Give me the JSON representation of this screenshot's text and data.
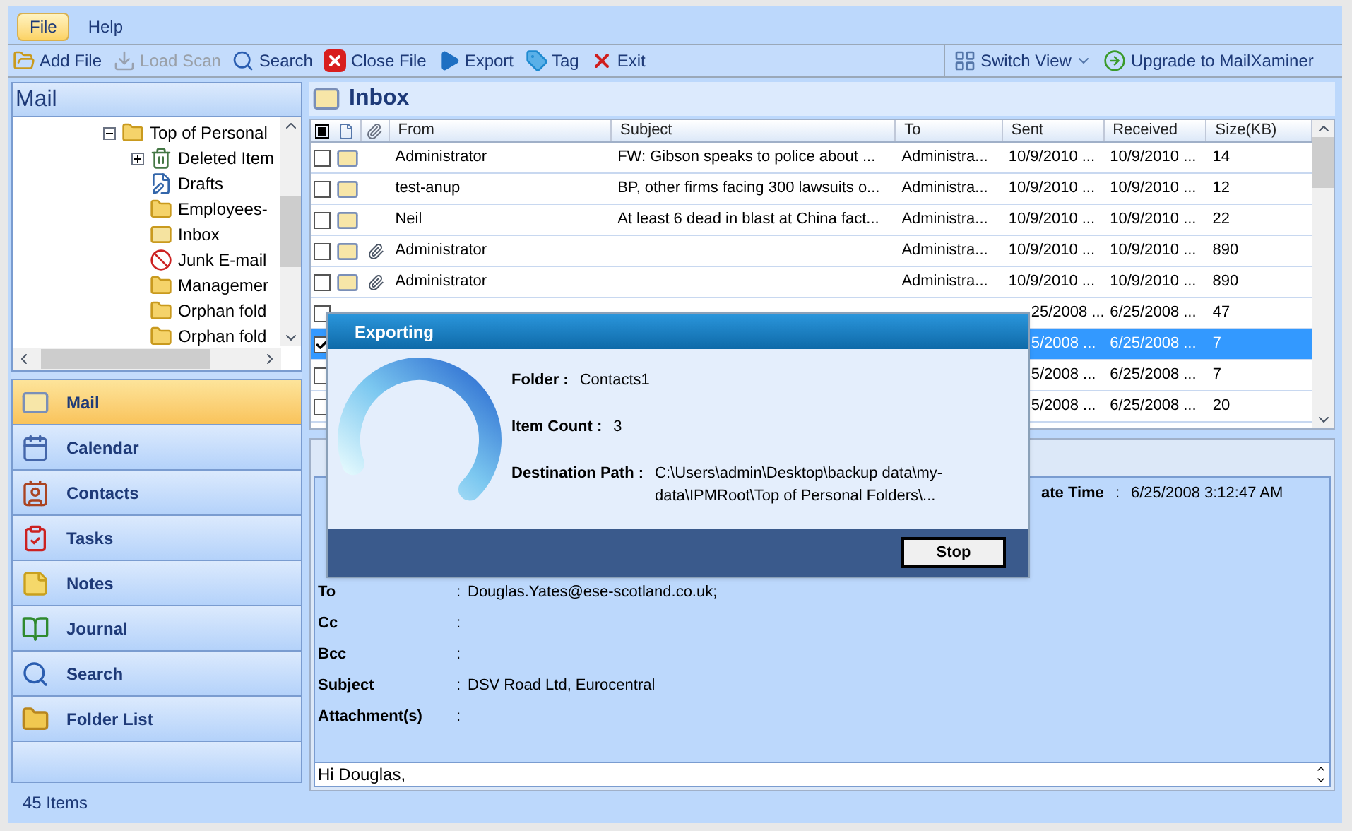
{
  "menu": [
    {
      "label": "File",
      "selected": true
    },
    {
      "label": "Help",
      "selected": false
    }
  ],
  "toolbar": [
    {
      "kind": "open",
      "label": "Add File",
      "disabled": false
    },
    {
      "kind": "download",
      "label": "Load Scan",
      "disabled": true
    },
    {
      "kind": "search",
      "label": "Search",
      "disabled": false
    },
    {
      "kind": "close",
      "label": "Close File",
      "disabled": false
    },
    {
      "kind": "play",
      "label": "Export",
      "disabled": false
    },
    {
      "kind": "tag",
      "label": "Tag",
      "disabled": false
    },
    {
      "kind": "exit",
      "label": "Exit",
      "disabled": false
    }
  ],
  "toolbar_right": [
    {
      "kind": "grid",
      "label": "Switch View",
      "dropdown": true
    },
    {
      "kind": "arrow",
      "label": "Upgrade to MailXaminer",
      "dropdown": false
    }
  ],
  "left_pane": {
    "title": "Mail",
    "tree": [
      {
        "label": "Top of Personal",
        "kind": "folder",
        "expanded": true,
        "children": [
          {
            "label": "Deleted Item",
            "kind": "deleted",
            "expanded": false
          },
          {
            "label": "Drafts",
            "kind": "drafts"
          },
          {
            "label": "Employees-",
            "kind": "folder"
          },
          {
            "label": "Inbox",
            "kind": "inbox"
          },
          {
            "label": "Junk E-mail",
            "kind": "junk"
          },
          {
            "label": "Managemer",
            "kind": "folder"
          },
          {
            "label": "Orphan fold",
            "kind": "folder"
          },
          {
            "label": "Orphan fold",
            "kind": "folder"
          }
        ]
      }
    ]
  },
  "nav": [
    {
      "kind": "mail",
      "label": "Mail",
      "selected": true
    },
    {
      "kind": "calendar",
      "label": "Calendar",
      "selected": false
    },
    {
      "kind": "contacts",
      "label": "Contacts",
      "selected": false
    },
    {
      "kind": "tasks",
      "label": "Tasks",
      "selected": false
    },
    {
      "kind": "notes",
      "label": "Notes",
      "selected": false
    },
    {
      "kind": "journal",
      "label": "Journal",
      "selected": false
    },
    {
      "kind": "search",
      "label": "Search",
      "selected": false
    },
    {
      "kind": "folder",
      "label": "Folder List",
      "selected": false
    }
  ],
  "status_bar": "45 Items",
  "inbox": {
    "title": "Inbox",
    "select_all_indeterminate": true,
    "columns": [
      "From",
      "Subject",
      "To",
      "Sent",
      "Received",
      "Size(KB)"
    ],
    "rows": [
      {
        "checked": false,
        "attachment": false,
        "selected": false,
        "from": "Administrator",
        "subject": "FW: Gibson speaks to police about ...",
        "to": "Administra...",
        "sent": "10/9/2010 ...",
        "received": "10/9/2010 ...",
        "size": "14"
      },
      {
        "checked": false,
        "attachment": false,
        "selected": false,
        "from": "test-anup",
        "subject": "BP, other firms facing 300 lawsuits o...",
        "to": "Administra...",
        "sent": "10/9/2010 ...",
        "received": "10/9/2010 ...",
        "size": "12"
      },
      {
        "checked": false,
        "attachment": false,
        "selected": false,
        "from": "Neil",
        "subject": "At least 6 dead in blast at China fact...",
        "to": "Administra...",
        "sent": "10/9/2010 ...",
        "received": "10/9/2010 ...",
        "size": "22"
      },
      {
        "checked": false,
        "attachment": true,
        "selected": false,
        "from": "Administrator",
        "to": "Administra...",
        "sent": "10/9/2010 ...",
        "received": "10/9/2010 ...",
        "size": "890"
      },
      {
        "checked": false,
        "attachment": true,
        "selected": false,
        "from": "Administrator",
        "to": "Administra...",
        "sent": "10/9/2010 ...",
        "received": "10/9/2010 ...",
        "size": "890"
      },
      {
        "checked": false,
        "selected": false,
        "sent": "25/2008 ...",
        "received": "6/25/2008 ...",
        "size": "47"
      },
      {
        "checked": true,
        "selected": true,
        "sent": "5/2008 ...",
        "received": "6/25/2008 ...",
        "size": "7"
      },
      {
        "checked": false,
        "selected": false,
        "sent": "5/2008 ...",
        "received": "6/25/2008 ...",
        "size": "7"
      },
      {
        "checked": false,
        "selected": false,
        "sent": "5/2008 ...",
        "received": "6/25/2008 ...",
        "size": "20"
      }
    ]
  },
  "preview": {
    "header_right": {
      "label": "ate Time",
      "separator": ":",
      "value": "6/25/2008 3:12:47 AM"
    },
    "fields": [
      {
        "label": "To",
        "separator": ":",
        "value": "Douglas.Yates@ese-scotland.co.uk;"
      },
      {
        "label": "Cc",
        "separator": ":"
      },
      {
        "label": "Bcc",
        "separator": ":"
      },
      {
        "label": "Subject",
        "separator": ":",
        "value": "DSV Road Ltd, Eurocentral"
      },
      {
        "label": "Attachment(s)",
        "separator": ":"
      }
    ],
    "body": "Hi Douglas,"
  },
  "dialog": {
    "title": "Exporting",
    "fields": [
      {
        "label": "Folder :",
        "value": "Contacts1"
      },
      {
        "label": "Item Count :",
        "value": "3"
      },
      {
        "label": "Destination Path :",
        "value": "C:\\Users\\admin\\Desktop\\backup data\\my-data\\IPMRoot\\Top of Personal Folders\\..."
      }
    ],
    "button": "Stop"
  }
}
